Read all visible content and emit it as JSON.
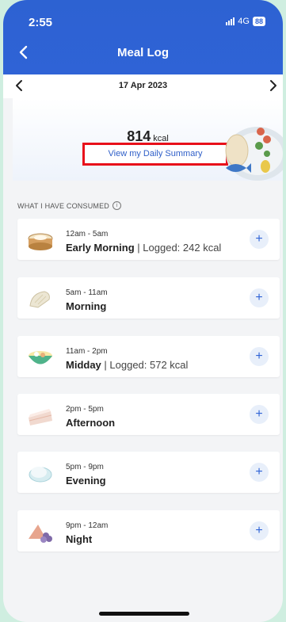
{
  "status": {
    "time": "2:55",
    "network": "4G",
    "battery": "88"
  },
  "header": {
    "title": "Meal Log"
  },
  "date": {
    "label": "17 Apr 2023"
  },
  "summary": {
    "kcal_value": "814",
    "kcal_unit": "kcal",
    "link_label": "View my Daily Summary"
  },
  "section": {
    "title": "WHAT I HAVE CONSUMED",
    "info_glyph": "i"
  },
  "meals": [
    {
      "time": "12am - 5am",
      "name": "Early Morning",
      "logged": " | Logged: 242 kcal",
      "icon": "dumpling-basket-icon"
    },
    {
      "time": "5am - 11am",
      "name": "Morning",
      "logged": "",
      "icon": "bread-icon"
    },
    {
      "time": "11am - 2pm",
      "name": "Midday",
      "logged": " | Logged: 572 kcal",
      "icon": "noodle-bowl-icon"
    },
    {
      "time": "2pm - 5pm",
      "name": "Afternoon",
      "logged": "",
      "icon": "cake-slice-icon"
    },
    {
      "time": "5pm - 9pm",
      "name": "Evening",
      "logged": "",
      "icon": "bun-icon"
    },
    {
      "time": "9pm - 12am",
      "name": "Night",
      "logged": "",
      "icon": "fruit-snack-icon"
    }
  ],
  "colors": {
    "accent": "#2f63d6",
    "highlight_box": "#e8101a",
    "page_bg": "#f3f4f6"
  }
}
